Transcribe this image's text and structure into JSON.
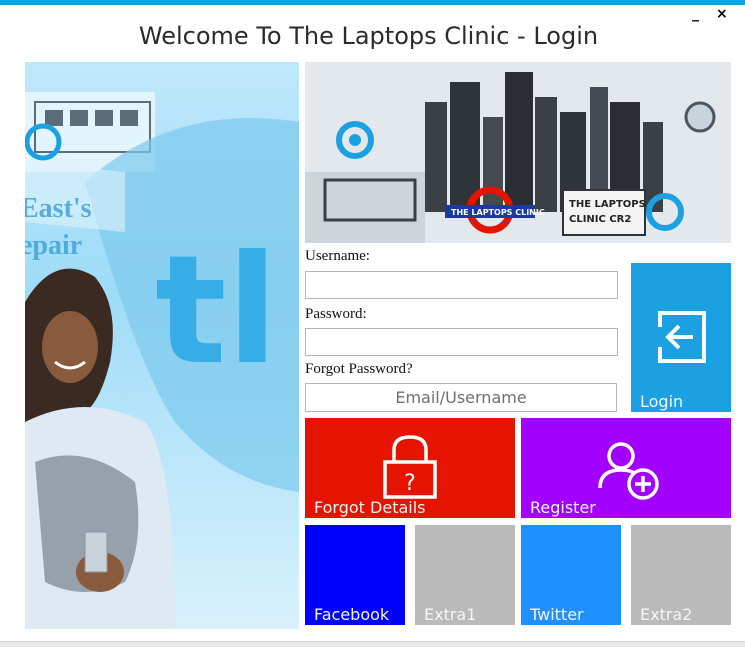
{
  "window": {
    "title": "Welcome To The Laptops Clinic - Login",
    "minimize_glyph": "_",
    "close_glyph": "×"
  },
  "form": {
    "username_label": "Username:",
    "username_value": "",
    "password_label": "Password:",
    "password_value": "",
    "forgot_label": "Forgot Password?",
    "email_placeholder": "Email/Username"
  },
  "tiles": {
    "login": "Login",
    "forgot_details": "Forgot Details",
    "register": "Register",
    "facebook": "Facebook",
    "extra1": "Extra1",
    "twitter": "Twitter",
    "extra2": "Extra2"
  },
  "images": {
    "hero_photo_icon": "woman-photo-icon",
    "banner_icon": "city-skyline-banner-icon",
    "banner_sign_text_1": "THE LAPTOPS CLINIC",
    "banner_sign_text_2": "THE LAPTOPS",
    "banner_sign_text_3": "CLINIC CR2",
    "hero_text_1": "East's",
    "hero_text_2": "epair"
  },
  "colors": {
    "accent": "#1ba1e2",
    "login_tile": "#1ba1e2",
    "forgot_tile": "#e51400",
    "register_tile": "#a200ff",
    "facebook_tile": "#0000ff",
    "twitter_tile": "#1e90ff",
    "extra_tile": "#bababa"
  }
}
